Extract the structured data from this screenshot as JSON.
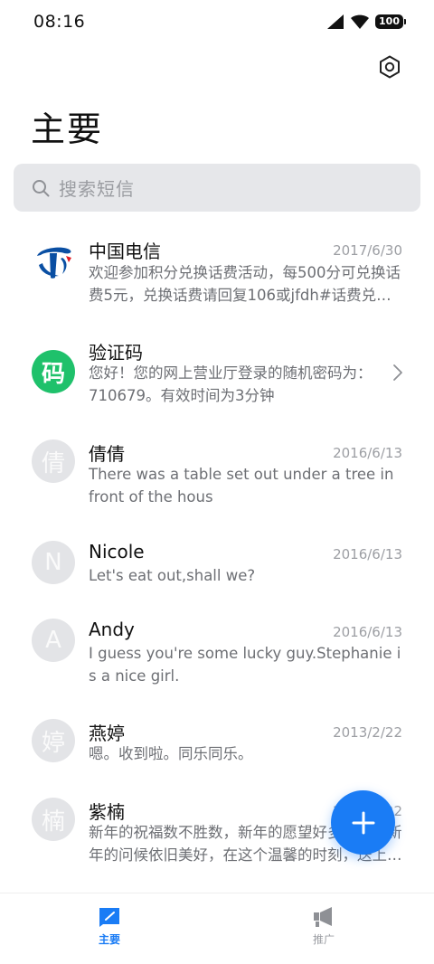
{
  "status_bar": {
    "time": "08:16",
    "battery": "100",
    "icons": [
      "signal-icon",
      "wifi-icon",
      "battery-icon"
    ]
  },
  "header": {
    "title": "主要",
    "settings_icon": "gear-icon"
  },
  "search": {
    "placeholder": "搜索短信"
  },
  "conversations": [
    {
      "name": "中国电信",
      "date": "2017/6/30",
      "preview": "欢迎参加积分兑换话费活动，每500分可兑换话费5元，兑换话费请回复106或jfdh#话费兑换代码",
      "avatar": "china-telecom-logo"
    },
    {
      "name": "验证码",
      "date": "",
      "preview": "您好！您的网上营业厅登录的随机密码为：710679。有效时间为3分钟",
      "avatar_text": "码",
      "avatar_color": "#1fc16b"
    },
    {
      "name": "倩倩",
      "date": "2016/6/13",
      "preview": "There was a table set out under a tree in front of the hous",
      "avatar_text": "倩"
    },
    {
      "name": "Nicole",
      "date": "2016/6/13",
      "preview": "Let's eat out,shall we?",
      "avatar_text": "N"
    },
    {
      "name": "Andy",
      "date": "2016/6/13",
      "preview": "I guess you're some lucky guy.Stephanie is a nice girl.",
      "avatar_text": "A"
    },
    {
      "name": "燕婷",
      "date": "2013/2/22",
      "preview": "嗯。收到啦。同乐同乐。",
      "avatar_text": "婷"
    },
    {
      "name": "紫楠",
      "date": "2013/2/22",
      "preview": "新年的祝福数不胜数，新年的愿望好多好多，新年的问候依旧美好，在这个温馨的时刻，送上最真挚的祝福",
      "avatar_text": "楠"
    }
  ],
  "fab": {
    "icon": "plus-icon"
  },
  "bottom_nav": {
    "items": [
      {
        "label": "主要",
        "icon": "message-icon",
        "active": true
      },
      {
        "label": "推广",
        "icon": "megaphone-icon",
        "active": false
      }
    ]
  },
  "colors": {
    "accent": "#1a7cf5",
    "green_avatar": "#1fc16b",
    "grey_avatar": "#e3e4e7",
    "search_bg": "#e6e7ea"
  }
}
